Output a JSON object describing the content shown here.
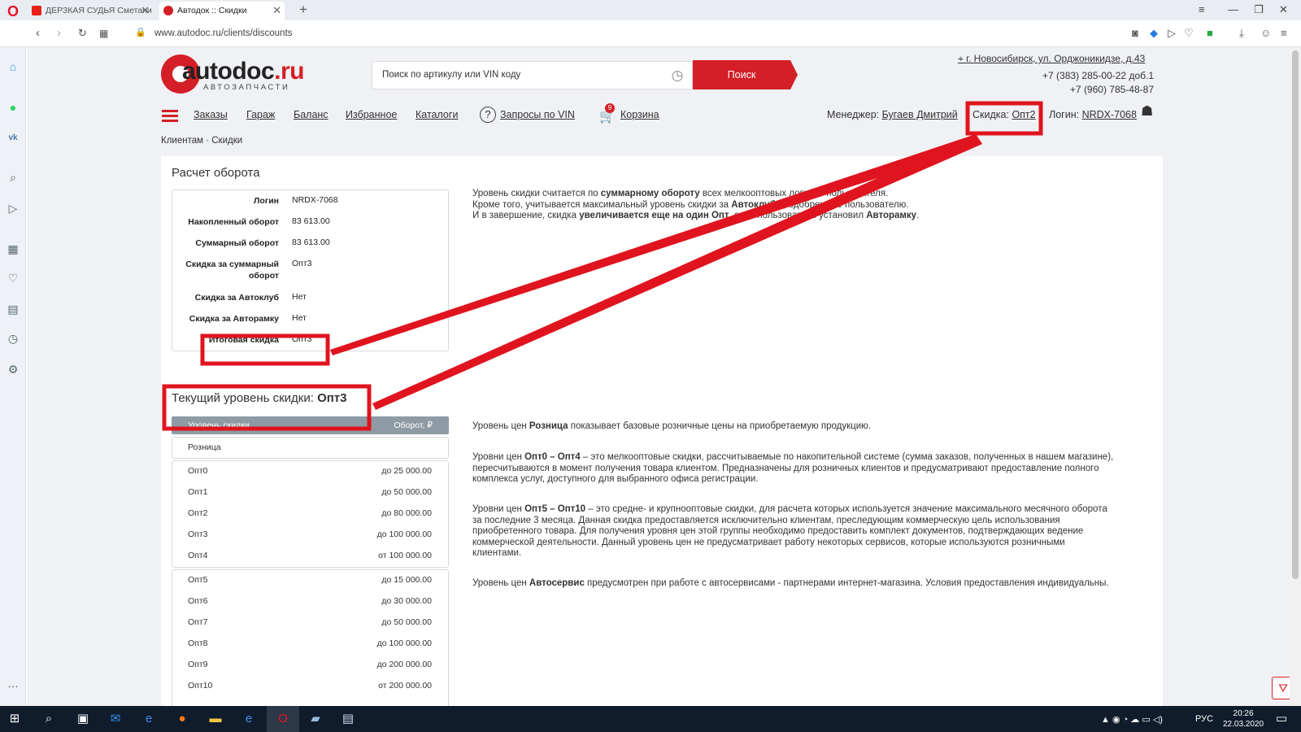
{
  "browser": {
    "tabs": [
      {
        "title": "ДЕРЗКАЯ СУДЬЯ Сметани"
      },
      {
        "title": "Автодок :: Скидки"
      }
    ],
    "url": "www.autodoc.ru/clients/discounts"
  },
  "header": {
    "logo_text_main": "autodoc",
    "logo_text_ru": ".ru",
    "logo_subtitle": "АВТОЗАПЧАСТИ",
    "search_placeholder": "Поиск по артикулу или VIN коду",
    "search_button": "Поиск",
    "address": "г. Новосибирск, ул. Орджоникидзе, д.43",
    "phone1": "+7 (383) 285-00-22 доб.1",
    "phone2": "+7 (960) 785-48-87"
  },
  "nav": {
    "orders": "Заказы",
    "garage": "Гараж",
    "balance": "Баланс",
    "favorites": "Избранное",
    "catalogs": "Каталоги",
    "vin_requests": "Запросы по VIN",
    "cart": "Корзина",
    "cart_count": "9",
    "manager_label": "Менеджер:",
    "manager_name": "Бугаев Дмитрий",
    "discount_label": "Скидка:",
    "discount_value": "Опт2",
    "login_label": "Логин:",
    "login_value": "NRDX-7068"
  },
  "breadcrumb": "Клиентам · Скидки",
  "turnover": {
    "title": "Расчет оборота",
    "rows": [
      {
        "key": "Логин",
        "value": "NRDX-7068"
      },
      {
        "key": "Накопленный оборот",
        "value": "83 613.00"
      },
      {
        "key": "Суммарный оборот",
        "value": "83 613.00"
      },
      {
        "key": "Скидка за суммарный оборот",
        "value": "Опт3"
      },
      {
        "key": "Скидка за Автоклуб",
        "value": "Нет"
      },
      {
        "key": "Скидка за Авторамку",
        "value": "Нет"
      },
      {
        "key": "Итоговая скидка",
        "value": "Опт3"
      }
    ]
  },
  "info_text": {
    "l1_a": "Уровень скидки считается по ",
    "l1_b": "суммарному обороту",
    "l1_c": " всех мелкооптовых логинов пользователя.",
    "l2_a": "Кроме того, учитывается максимальный уровень скидки за ",
    "l2_b": "Автоклубы",
    "l2_c": ", одобренные пользователю.",
    "l3_a": "И в завершение, скидка ",
    "l3_b": "увеличивается еще на один Опт",
    "l3_c": ", если пользователь установил ",
    "l3_d": "Авторамку",
    "l3_e": "."
  },
  "current_level": {
    "label": "Текущий уровень скидки:",
    "value": "Опт3"
  },
  "levels": {
    "col_level": "Уровень скидки",
    "col_turnover": "Оборот, ₽",
    "retail": "Розница",
    "group1": [
      {
        "name": "Опт0",
        "turnover": "до 25 000.00"
      },
      {
        "name": "Опт1",
        "turnover": "до 50 000.00"
      },
      {
        "name": "Опт2",
        "turnover": "до 80 000.00"
      },
      {
        "name": "Опт3",
        "turnover": "до 100 000.00"
      },
      {
        "name": "Опт4",
        "turnover": "от 100 000.00"
      }
    ],
    "group2": [
      {
        "name": "Опт5",
        "turnover": "до 15 000.00"
      },
      {
        "name": "Опт6",
        "turnover": "до 30 000.00"
      },
      {
        "name": "Опт7",
        "turnover": "до 50 000.00"
      },
      {
        "name": "Опт8",
        "turnover": "до 100 000.00"
      },
      {
        "name": "Опт9",
        "turnover": "до 200 000.00"
      },
      {
        "name": "Опт10",
        "turnover": "от 200 000.00"
      }
    ]
  },
  "descriptions": {
    "retail_a": "Уровень цен ",
    "retail_b": "Розница",
    "retail_c": " показывает базовые розничные цены на приобретаемую продукцию.",
    "small_a": "Уровни цен ",
    "small_b": "Опт0 – Опт4",
    "small_c": " – это мелкооптовые скидки, рассчитываемые по накопительной системе (сумма заказов, полученных в нашем магазине), пересчитываются в момент получения товара клиентом. Предназначены для розничных клиентов и предусматривают предоставление полного комплекса услуг, доступного для выбранного офиса регистрации.",
    "mid_a": "Уровни цен ",
    "mid_b": "Опт5 – Опт10",
    "mid_c": " – это средне- и крупнооптовые скидки, для расчета которых используется значение максимального месячного оборота за последние 3 месяца. Данная скидка предоставляется исключительно клиентам, преследующим коммерческую цель использования приобретенного товара. Для получения уровня цен этой группы необходимо предоставить комплект документов, подтверждающих ведение коммерческой деятельности. Данный уровень цен не предусматривает работу некоторых сервисов, которые используются розничными клиентами.",
    "service_a": "Уровень цен ",
    "service_b": "Автосервис",
    "service_c": " предусмотрен при работе с автосервисами - партнерами интернет-магазина. Условия предоставления индивидуальны."
  },
  "taskbar": {
    "lang": "РУС",
    "time": "20:26",
    "date": "22.03.2020"
  },
  "colors": {
    "brand_red": "#d41f27",
    "annotation_red": "#e0141e"
  }
}
